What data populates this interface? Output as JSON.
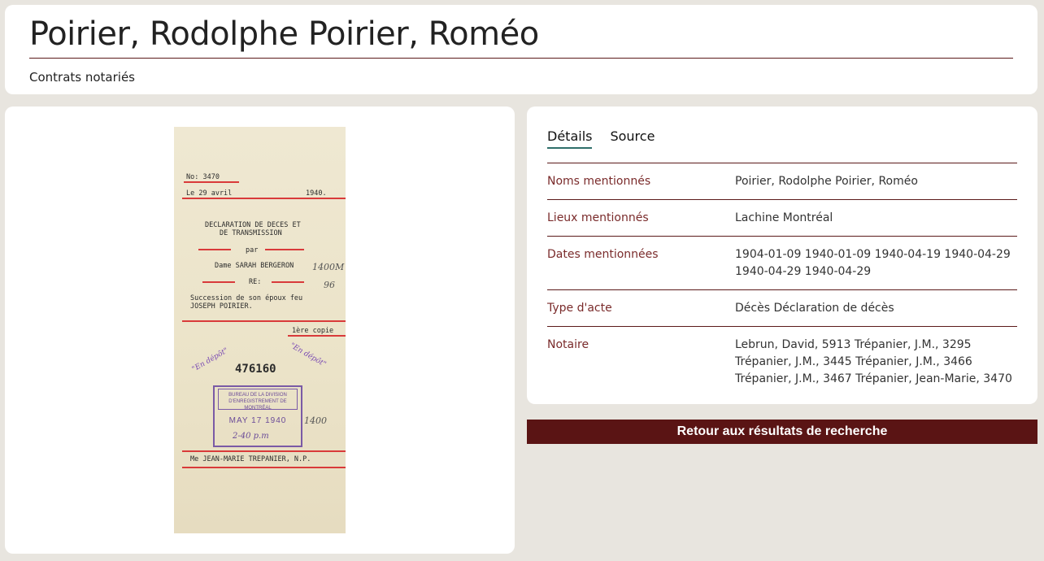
{
  "header": {
    "title": "Poirier, Rodolphe Poirier, Roméo",
    "collection": "Contrats notariés"
  },
  "document_image": {
    "no_line": "No: 3470",
    "date_line_left": "Le 29 avril",
    "date_line_right": "1940.",
    "heading_1": "DECLARATION DE DECES ET",
    "heading_2": "DE TRANSMISSION",
    "par": "par",
    "party": "Dame SARAH BERGERON",
    "re": "RE:",
    "subject_1": "Succession de son époux feu",
    "subject_2": "JOSEPH POIRIER.",
    "copie": "1ère copie",
    "number": "476160",
    "stamp_text": "BUREAU DE LA DIVISION D'ENREGISTREMENT DE MONTRÉAL",
    "stamp_date": "MAY 17 1940",
    "notary_line": "Me JEAN-MARIE TREPANIER, N.P.",
    "hand_1": "1400M",
    "hand_2": "96",
    "hand_3": "1400",
    "hand_4": "2-40 p.m",
    "purple_1": "\"En dépôt\"",
    "purple_2": "\"En dépôt\""
  },
  "tabs": [
    {
      "label": "Détails",
      "active": true
    },
    {
      "label": "Source",
      "active": false
    }
  ],
  "details": [
    {
      "label": "Noms mentionnés",
      "value": "Poirier, Rodolphe Poirier, Roméo"
    },
    {
      "label": "Lieux mentionnés",
      "value": "Lachine Montréal"
    },
    {
      "label": "Dates mentionnées",
      "value": "1904-01-09 1940-01-09 1940-04-19 1940-04-29 1940-04-29 1940-04-29"
    },
    {
      "label": "Type d'acte",
      "value": "Décès Déclaration de décès"
    },
    {
      "label": "Notaire",
      "value": "Lebrun, David, 5913 Trépanier, J.M., 3295 Trépanier, J.M., 3445 Trépanier, J.M., 3466 Trépanier, J.M., 3467 Trépanier, Jean-Marie, 3470"
    }
  ],
  "back_button": "Retour aux résultats de recherche",
  "colors": {
    "background": "#e8e5df",
    "accent": "#5a1414",
    "label": "#7a2b2b",
    "tab_underline": "#2f6f6a"
  }
}
